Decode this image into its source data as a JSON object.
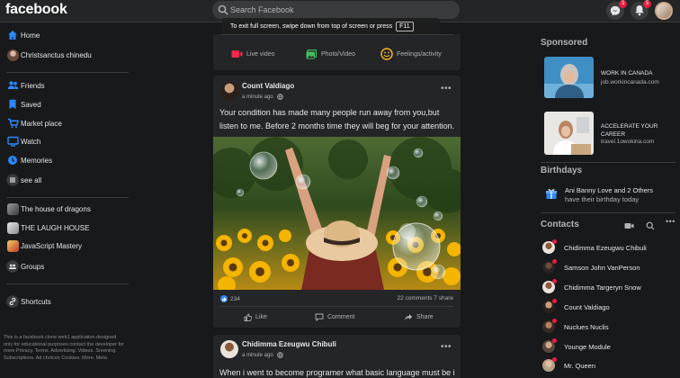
{
  "header": {
    "logo": "facebook",
    "search_placeholder": "Search Facebook",
    "fullscreen_notice": "To exit full screen, swipe down from top of screen or press",
    "fullscreen_key": "F11",
    "messenger_badge": "3",
    "notifications_badge": "5"
  },
  "sidebar": {
    "items": [
      {
        "label": "Home",
        "icon": "home-icon"
      },
      {
        "label": "Christsanctus chinedu",
        "icon": "avatar"
      },
      {
        "label": "Friends",
        "icon": "friends-icon"
      },
      {
        "label": "Saved",
        "icon": "bookmark-icon"
      },
      {
        "label": "Market place",
        "icon": "shop-icon"
      },
      {
        "label": "Watch",
        "icon": "tv-icon"
      },
      {
        "label": "Memories",
        "icon": "clock-icon"
      },
      {
        "label": "see all",
        "icon": "grid-icon"
      }
    ],
    "groups": [
      {
        "label": "The house of dragons"
      },
      {
        "label": "THE LAUGH HOUSE"
      },
      {
        "label": "JavaScript Mastery"
      },
      {
        "label": "Groups"
      }
    ],
    "shortcuts_label": "Shortcuts",
    "footer": "This is a facebook clone web1 application designed only for educational purposes contact the developer for more Privacy. Terms. Advertising. Videos. Sreening. Subscriptions. Ad choices Cookies. More. Meta"
  },
  "composer": {
    "live_video": "Live video",
    "photo_video": "Photo/Video",
    "feeling": "Feelings/activity"
  },
  "posts": [
    {
      "author": "Count Valdiago",
      "time": "a minute ago",
      "text": "Your condition has made many people run away from you,but listen to me. Before 2 months time they will beg for your attention.",
      "likes": "234",
      "stats": "22 comments 7 share",
      "like_label": "Like",
      "comment_label": "Comment",
      "share_label": "Share"
    },
    {
      "author": "Chidimma Ezeugwu Chibuli",
      "time": "a minute ago",
      "text": "When i went to become programer what basic language must be i"
    }
  ],
  "right": {
    "sponsored_title": "Sponsored",
    "ads": [
      {
        "title": "WORK IN CANADA",
        "url": "job.workincanada.com"
      },
      {
        "title_line1": "ACCELERATE YOUR",
        "title_line2": "CAREER",
        "url": "travel.1owokina.com"
      }
    ],
    "birthdays_title": "Birthdays",
    "birthday_name1": "Ani Banny Love",
    "birthday_and": " and ",
    "birthday_others": "2 Others",
    "birthday_rest": "have their birthday today",
    "contacts_title": "Contacts",
    "contacts": [
      "Chidimma Ezeugwu Chibuli",
      "Samson John VanPerson",
      "Chidimma Targeryn Snow",
      "Count Valdiago",
      "Nuclues Nuclis",
      "Younge Module",
      "Mr. Queen"
    ]
  },
  "colors": {
    "background": "#18191a",
    "surface": "#242526",
    "accent": "#2d88ff",
    "text": "#e4e6eb",
    "muted": "#b0b3b8",
    "badge": "#e41e3f"
  }
}
